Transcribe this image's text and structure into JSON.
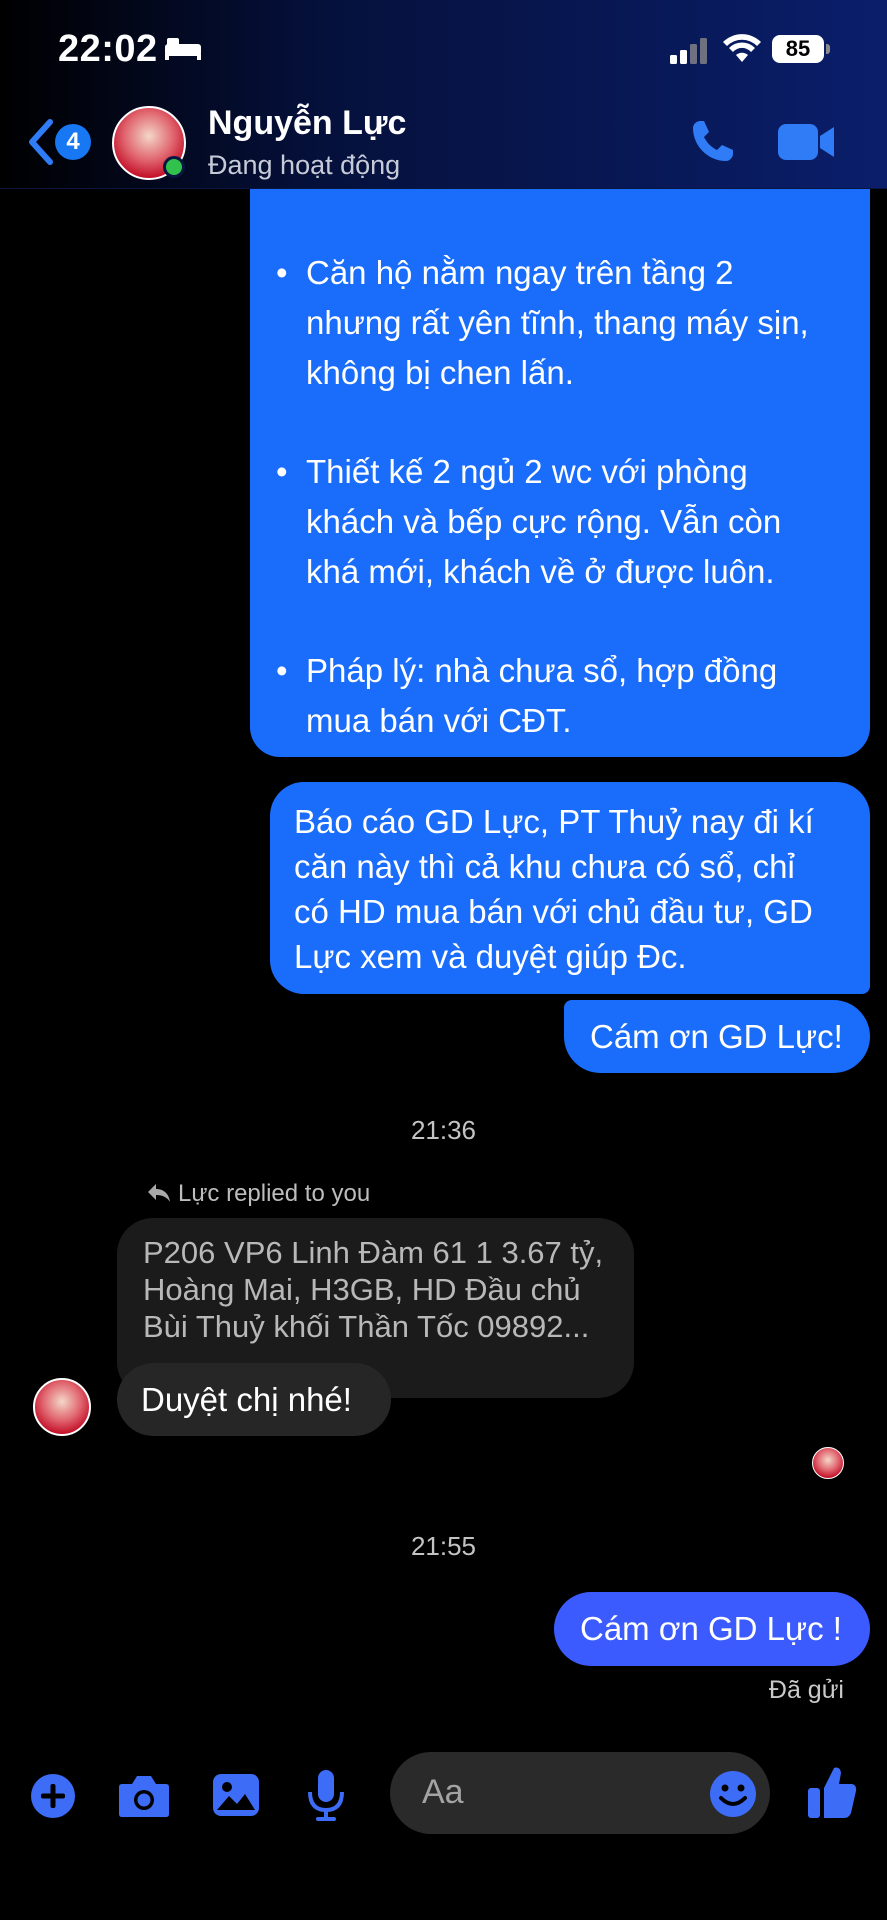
{
  "status_bar": {
    "time": "22:02",
    "battery": "85"
  },
  "header": {
    "back_count": "4",
    "contact_name": "Nguyễn Lực",
    "contact_status": "Đang hoạt động"
  },
  "messages": {
    "bullets": [
      [
        "Căn hộ nằm ngay trên tầng 2",
        "nhưng rất yên tĩnh, thang máy sịn,",
        "không bị chen lấn."
      ],
      [
        "Thiết kế 2 ngủ 2 wc với phòng",
        "khách và bếp cực rộng. Vẫn còn",
        "khá mới, khách về ở được luôn."
      ],
      [
        "Pháp lý: nhà chưa sổ, hợp đồng",
        "mua bán với CĐT."
      ]
    ],
    "report": [
      "Báo cáo GD Lực, PT Thuỷ nay đi kí",
      "căn này thì cả khu chưa có sổ, chỉ",
      "có HD mua bán với chủ đầu tư, GD",
      "Lực xem và duyệt giúp Đc."
    ],
    "thanks_1": "Cám ơn GD Lực!",
    "time_1": "21:36",
    "reply_label": "Lực replied to you",
    "quoted": [
      "P206 VP6 Linh Đàm 61 1 3.67 tỷ,",
      "Hoàng Mai, H3GB, HD Đầu chủ",
      "Bùi Thuỷ khối Thần Tốc 09892..."
    ],
    "reply_text": "Duyệt chị nhé!",
    "time_2": "21:55",
    "thanks_2": "Cám ơn GD Lực !",
    "delivery_status": "Đã gửi"
  },
  "composer": {
    "placeholder": "Aa"
  },
  "colors": {
    "accent": "#1a6cfb",
    "incoming": "#262626",
    "header_blue": "#0a1e6b",
    "online": "#31c24d"
  }
}
